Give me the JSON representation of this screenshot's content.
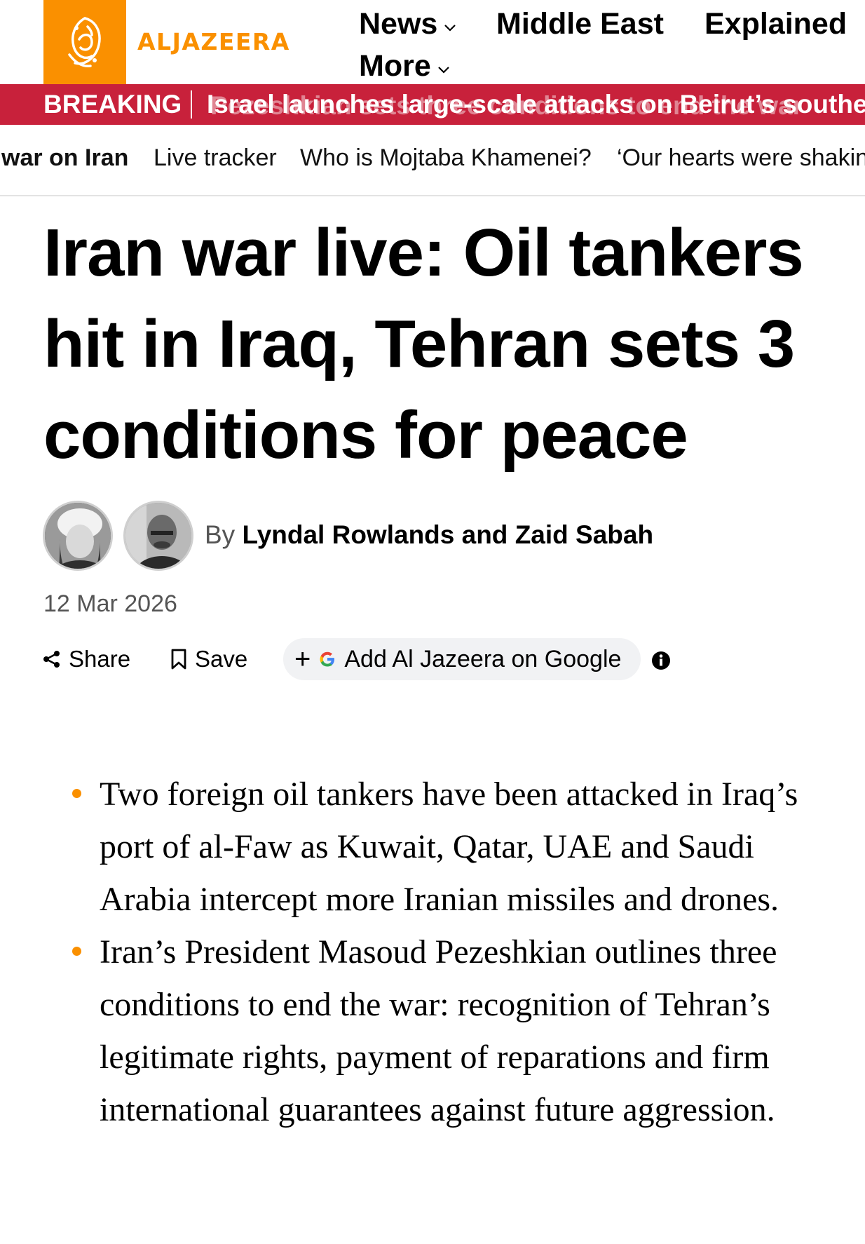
{
  "header": {
    "logo_text": "ALJAZEERA",
    "nav": {
      "news": "News",
      "middle_east": "Middle East",
      "explained": "Explained",
      "more": "More"
    }
  },
  "breaking": {
    "label": "BREAKING",
    "text": "Israel launches large-scale attacks on Beirut’s southern suburbs",
    "ghost_text": "Pezeshkian sets three conditions to end the war"
  },
  "topics": [
    "war on Iran",
    "Live tracker",
    "Who is Mojtaba Khamenei?",
    "‘Our hearts were shaking’"
  ],
  "article": {
    "headline": "Iran war live: Oil tankers hit in Iraq, Tehran sets 3 conditions for peace",
    "byline_prefix": "By",
    "authors": "Lyndal Rowlands and Zaid Sabah",
    "date": "12 Mar 2026"
  },
  "actions": {
    "share": "Share",
    "save": "Save",
    "google": "Add Al Jazeera on Google"
  },
  "summary": [
    "Two foreign oil tankers have been attacked in Iraq’s port of al-Faw as Kuwait, Qatar, UAE and Saudi Arabia intercept more Iranian missiles and drones.",
    "Iran’s President Masoud Pezeshkian outlines three conditions to end the war: recognition of Tehran’s legitimate rights, payment of reparations and firm international guarantees against future aggression."
  ],
  "colors": {
    "brand_orange": "#fa9000",
    "breaking_red": "#c8213b",
    "pill_bg": "#f1f2f4"
  },
  "icons": [
    "aljazeera-logo-icon",
    "chevron-down-icon",
    "share-icon",
    "bookmark-icon",
    "plus-icon",
    "google-g-icon",
    "info-icon"
  ]
}
